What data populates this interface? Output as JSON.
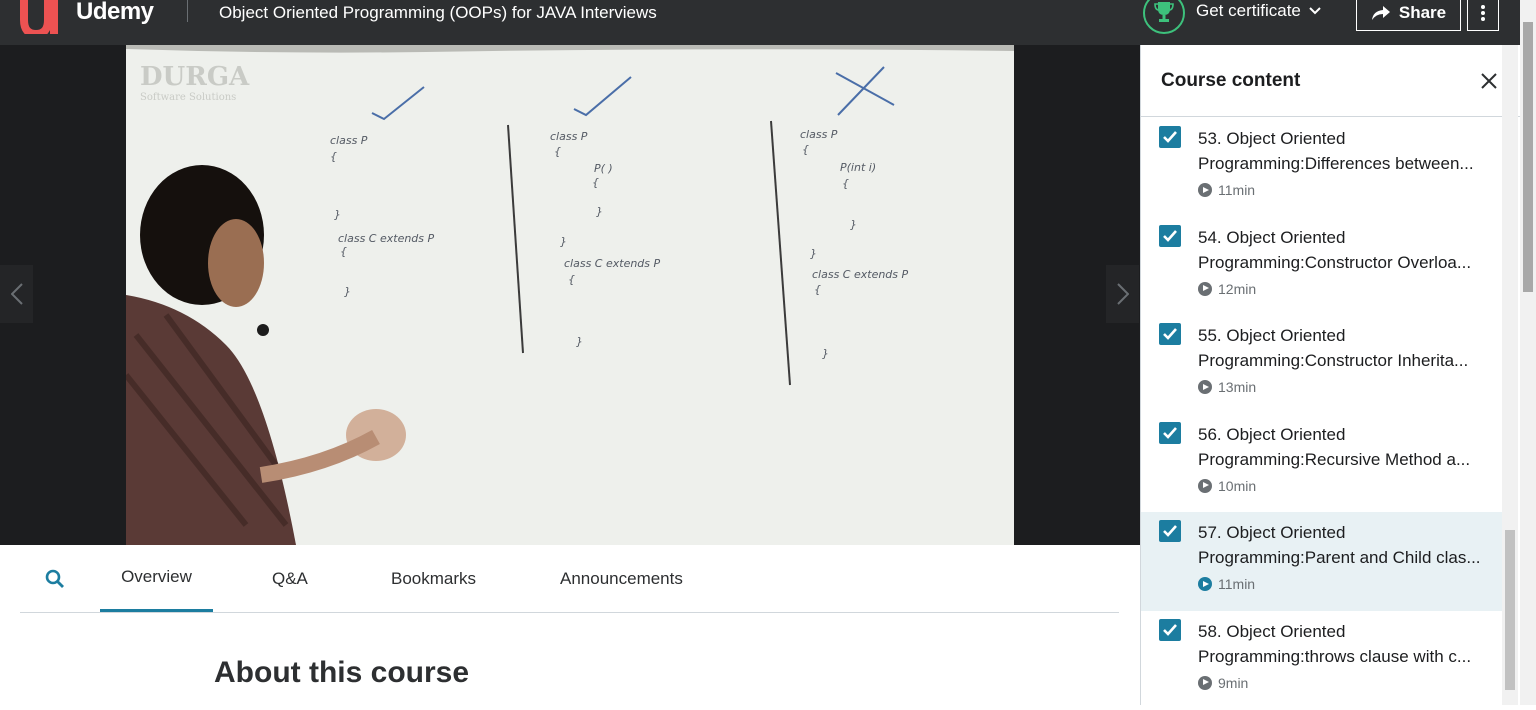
{
  "header": {
    "brand": "Udemy",
    "course_title": "Object Oriented Programming (OOPs) for JAVA Interviews",
    "certificate_label": "Get certificate",
    "share_label": "Share"
  },
  "tabs": [
    {
      "label": "Overview",
      "active": true
    },
    {
      "label": "Q&A",
      "active": false
    },
    {
      "label": "Bookmarks",
      "active": false
    },
    {
      "label": "Announcements",
      "active": false
    }
  ],
  "about_heading": "About this course",
  "sidebar": {
    "title": "Course content",
    "items": [
      {
        "title": "53. Object Oriented Programming:Differences between...",
        "duration": "11min",
        "checked": true
      },
      {
        "title": "54. Object Oriented Programming:Constructor Overloa...",
        "duration": "12min",
        "checked": true
      },
      {
        "title": "55. Object Oriented Programming:Constructor Inherita...",
        "duration": "13min",
        "checked": true
      },
      {
        "title": "56. Object Oriented Programming:Recursive Method a...",
        "duration": "10min",
        "checked": true
      },
      {
        "title": "57. Object Oriented Programming:Parent and Child clas...",
        "duration": "11min",
        "checked": true,
        "active": true
      },
      {
        "title": "58. Object Oriented Programming:throws clause with c...",
        "duration": "9min",
        "checked": true
      }
    ]
  },
  "video": {
    "watermark_line1": "DURGA",
    "watermark_line2": "Software Solutions",
    "board_text": {
      "col1": [
        "class P",
        "{",
        "}",
        "class C extends P",
        "{",
        "}"
      ],
      "col2": [
        "class P",
        "{",
        "P( )",
        "{",
        "}",
        "}",
        "class C extends P",
        "{",
        "}"
      ],
      "col3": [
        "class P",
        "{",
        "P(int i)",
        "{",
        "}",
        "}",
        "class C extends P",
        "{",
        "}"
      ]
    }
  },
  "colors": {
    "accent": "#1c7da0",
    "header_bg": "#2d2f31",
    "trophy": "#3dc17c",
    "active_row": "#e8f1f4"
  }
}
